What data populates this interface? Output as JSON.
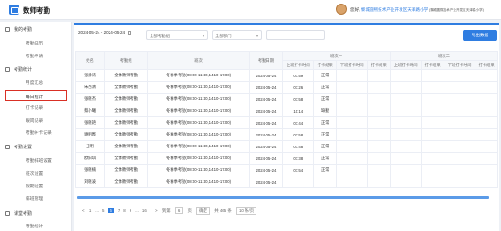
{
  "app": {
    "title": "数师考勤"
  },
  "header": {
    "greeting": "您好,",
    "school": "黎城圆熙技术产业开发区天泽路小学",
    "extra": "(黎城圆熙技术产业开发区天泽路小学)"
  },
  "sidebar": {
    "groups": [
      {
        "label": "我的考勤",
        "items": [
          "考勤日历",
          "考勤申请"
        ]
      },
      {
        "label": "考勤统计",
        "items": [
          "月度汇总",
          "每日统计",
          "打卡记录",
          "跟岗记录",
          "考勤补卡记录"
        ]
      },
      {
        "label": "考勤设置",
        "items": [
          "考勤排班设置",
          "班次设置",
          "假期设置",
          "排班管理"
        ]
      },
      {
        "label": "课堂考勤",
        "items": [
          "考勤统计"
        ]
      }
    ],
    "active": "每日统计"
  },
  "filters": {
    "date_range": "2024-05-24 - 2024-05-24",
    "group_select": "全部考勤组",
    "dept_select": "全部部门",
    "search_placeholder": "",
    "export_label": "导出数据"
  },
  "table": {
    "headers": {
      "name": "姓名",
      "group": "考勤组",
      "shift": "班次",
      "date": "考勤日期",
      "shift1": "班次一",
      "shift2": "班次二",
      "sub": [
        "上班打卡时间",
        "打卡结果",
        "下班打卡时间",
        "打卡结果",
        "上班打卡时间",
        "打卡结果",
        "下班打卡时间",
        "打卡结果"
      ]
    },
    "rows": [
      {
        "name": "张静涛",
        "group": "全体教师考勤",
        "shift": "冬春季考勤(08:00-11:40,14:10-17:00)",
        "date": "2024-05-24",
        "in_time": "07:59",
        "in_result": "正常"
      },
      {
        "name": "朱西清",
        "group": "全体教师考勤",
        "shift": "冬春季考勤(08:00-11:40,14:10-17:00)",
        "date": "2024-05-24",
        "in_time": "07:26",
        "in_result": "正常"
      },
      {
        "name": "张晓杰",
        "group": "全体教师考勤",
        "shift": "冬春季考勤(08:00-11:40,14:10-17:00)",
        "date": "2024-05-24",
        "in_time": "07:58",
        "in_result": "正常"
      },
      {
        "name": "蔡小曦",
        "group": "全体教师考勤",
        "shift": "冬春季考勤(08:00-11:40,14:10-17:00)",
        "date": "2024-05-24",
        "in_time": "10:14",
        "in_result": "缺勤"
      },
      {
        "name": "张晓艳",
        "group": "全体教师考勤",
        "shift": "冬春季考勤(08:00-11:40,14:10-17:00)",
        "date": "2024-05-24",
        "in_time": "07:44",
        "in_result": "正常"
      },
      {
        "name": "谢明晔",
        "group": "全体教师考勤",
        "shift": "冬春季考勤(08:00-11:40,14:10-17:00)",
        "date": "2024-05-24",
        "in_time": "07:58",
        "in_result": "正常"
      },
      {
        "name": "王明",
        "group": "全体教师考勤",
        "shift": "冬春季考勤(08:00-11:40,14:10-17:00)",
        "date": "2024-05-24",
        "in_time": "07:48",
        "in_result": "正常"
      },
      {
        "name": "欧阳琪",
        "group": "全体教师考勤",
        "shift": "冬春季考勤(08:00-11:40,14:10-17:00)",
        "date": "2024-05-24",
        "in_time": "07:38",
        "in_result": "正常"
      },
      {
        "name": "张晓楠",
        "group": "全体教师考勤",
        "shift": "冬春季考勤(08:00-11:40,14:10-17:00)",
        "date": "2024-05-24",
        "in_time": "07:54",
        "in_result": "正常"
      },
      {
        "name": "刘晓凌",
        "group": "全体教师考勤",
        "shift": "冬春季考勤(08:00-11:40,14:10-17:00)",
        "date": "2024-05-24",
        "in_time": "",
        "in_result": ""
      }
    ]
  },
  "pagination": {
    "prev": "<",
    "pages": [
      "1",
      "...",
      "5",
      "6",
      "7",
      "8",
      "9",
      "...",
      "16"
    ],
    "active": "6",
    "next": ">",
    "goto_label": "到第",
    "goto_value": "6",
    "page_unit": "页",
    "confirm": "确定",
    "total": "共 465 条",
    "page_size": "10 条/页"
  }
}
